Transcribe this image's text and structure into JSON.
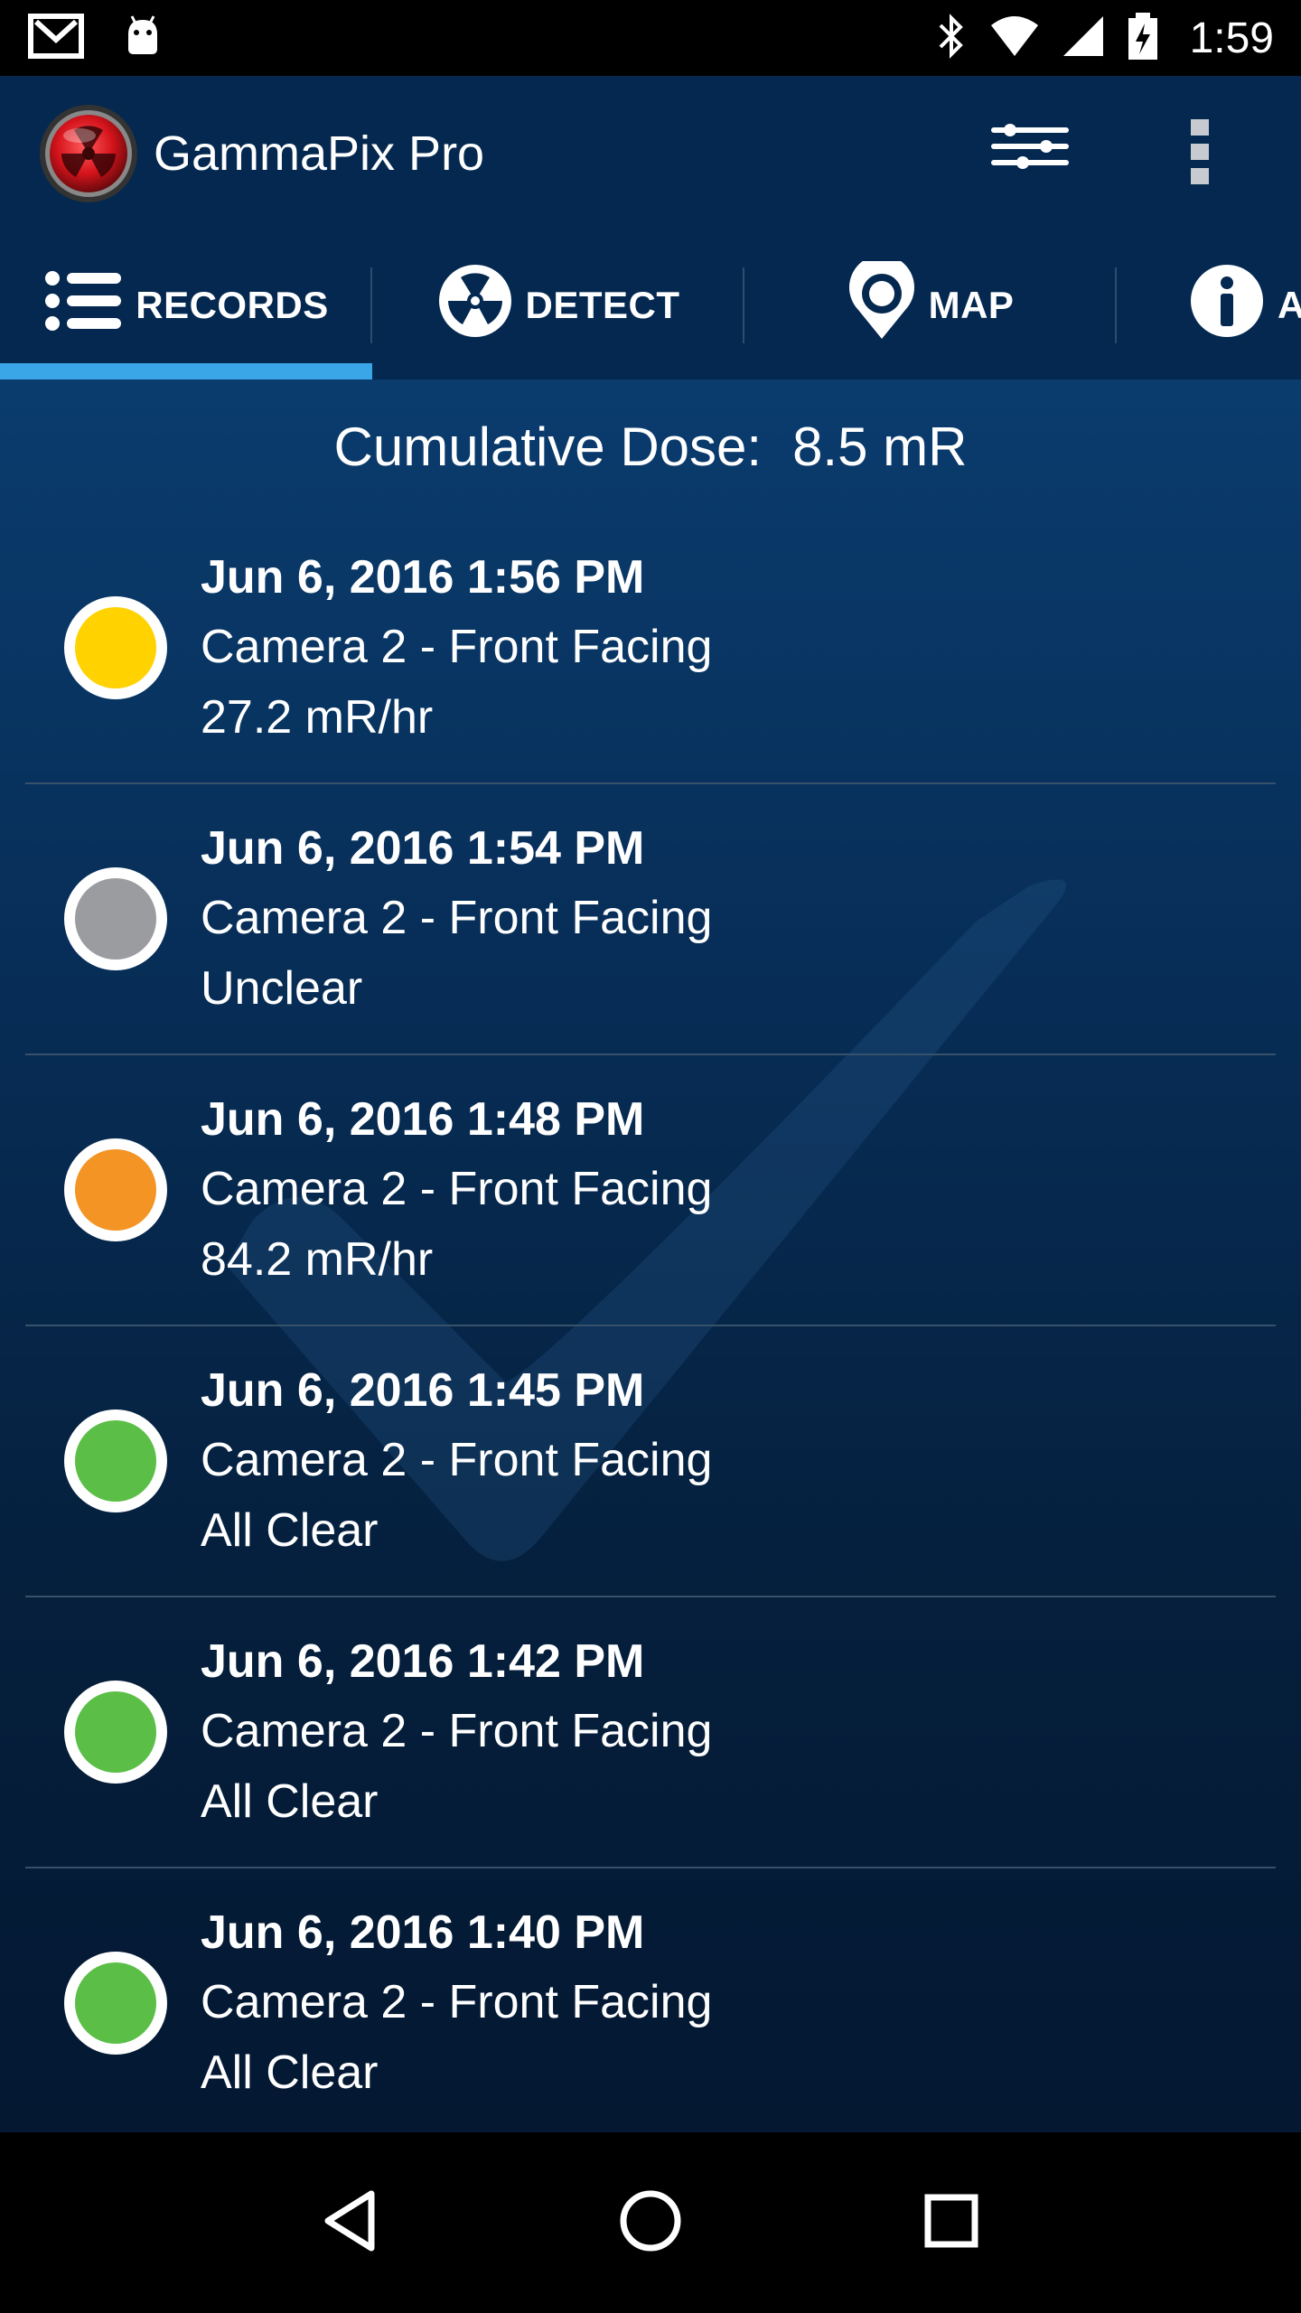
{
  "status_bar": {
    "time": "1:59",
    "icons": [
      "gmail-icon",
      "android-icon",
      "bluetooth-icon",
      "wifi-icon",
      "signal-icon",
      "battery-charging-icon"
    ]
  },
  "app_bar": {
    "title": "GammaPix Pro",
    "logo": "radiation-logo-icon",
    "actions": [
      "filter-settings-icon",
      "overflow-menu-icon"
    ]
  },
  "tabs": [
    {
      "label": "RECORDS",
      "icon": "list-icon",
      "active": true
    },
    {
      "label": "DETECT",
      "icon": "radiation-icon",
      "active": false
    },
    {
      "label": "MAP",
      "icon": "map-pin-icon",
      "active": false
    },
    {
      "label": "A",
      "icon": "info-icon",
      "active": false
    }
  ],
  "summary": {
    "label": "Cumulative Dose:",
    "value": "8.5 mR"
  },
  "records": [
    {
      "date": "Jun 6, 2016 1:56 PM",
      "camera": "Camera 2  - Front Facing",
      "result": "27.2 mR/hr",
      "status_color": "#ffd200"
    },
    {
      "date": "Jun 6, 2016 1:54 PM",
      "camera": "Camera 2  - Front Facing",
      "result": "Unclear",
      "status_color": "#9a9ca0"
    },
    {
      "date": "Jun 6, 2016 1:48 PM",
      "camera": "Camera 2  - Front Facing",
      "result": "84.2 mR/hr",
      "status_color": "#f39425"
    },
    {
      "date": "Jun 6, 2016 1:45 PM",
      "camera": "Camera 2  - Front Facing",
      "result": "All Clear",
      "status_color": "#5bbf47"
    },
    {
      "date": "Jun 6, 2016 1:42 PM",
      "camera": "Camera 2  - Front Facing",
      "result": "All Clear",
      "status_color": "#5bbf47"
    },
    {
      "date": "Jun 6, 2016 1:40 PM",
      "camera": "Camera 2  - Front Facing",
      "result": "All Clear",
      "status_color": "#5bbf47"
    }
  ],
  "colors": {
    "app_bar": "#04284f",
    "tab_indicator": "#3aa6e8"
  },
  "nav_bar": [
    "back-icon",
    "home-icon",
    "recents-icon"
  ]
}
